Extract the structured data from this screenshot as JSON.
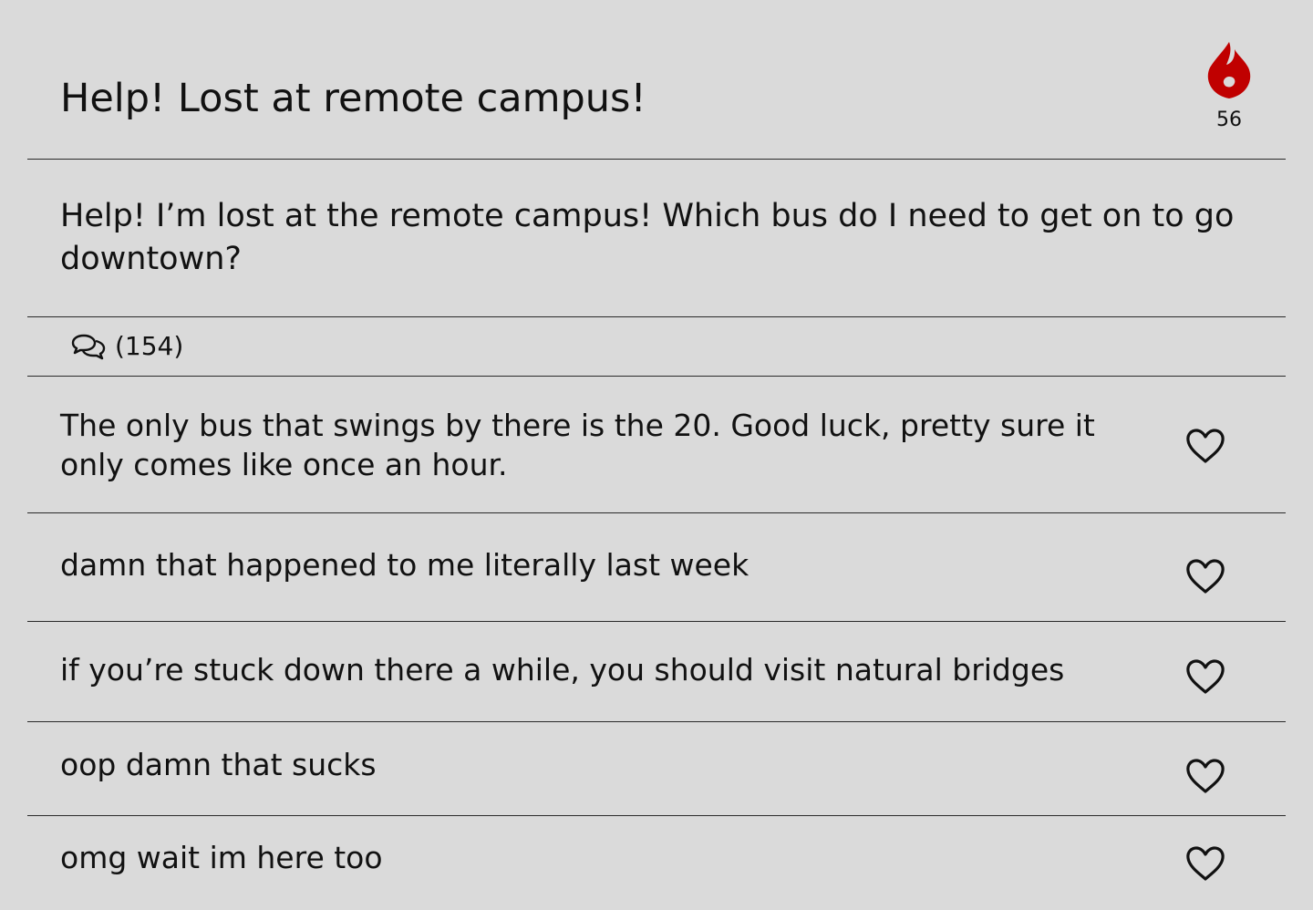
{
  "post": {
    "title": "Help! Lost at remote campus!",
    "heat": {
      "icon": "flame-icon",
      "count": "56",
      "color": "#c00000"
    },
    "body": "Help! I’m lost at the remote campus! Which bus do I need to get on to go downtown?"
  },
  "comments": {
    "icon": "comments-icon",
    "count_label": "(154)"
  },
  "replies": [
    {
      "text": "The only bus that swings by there is the 20. Good luck, pretty sure it only comes like once an hour.",
      "like_icon": "heart-icon"
    },
    {
      "text": "damn that happened to me literally last week",
      "like_icon": "heart-icon"
    },
    {
      "text": "if you’re stuck down there a while, you should visit natural bridges",
      "like_icon": "heart-icon"
    },
    {
      "text": "oop damn that sucks",
      "like_icon": "heart-icon"
    },
    {
      "text": "omg wait im here too",
      "like_icon": "heart-icon"
    }
  ]
}
